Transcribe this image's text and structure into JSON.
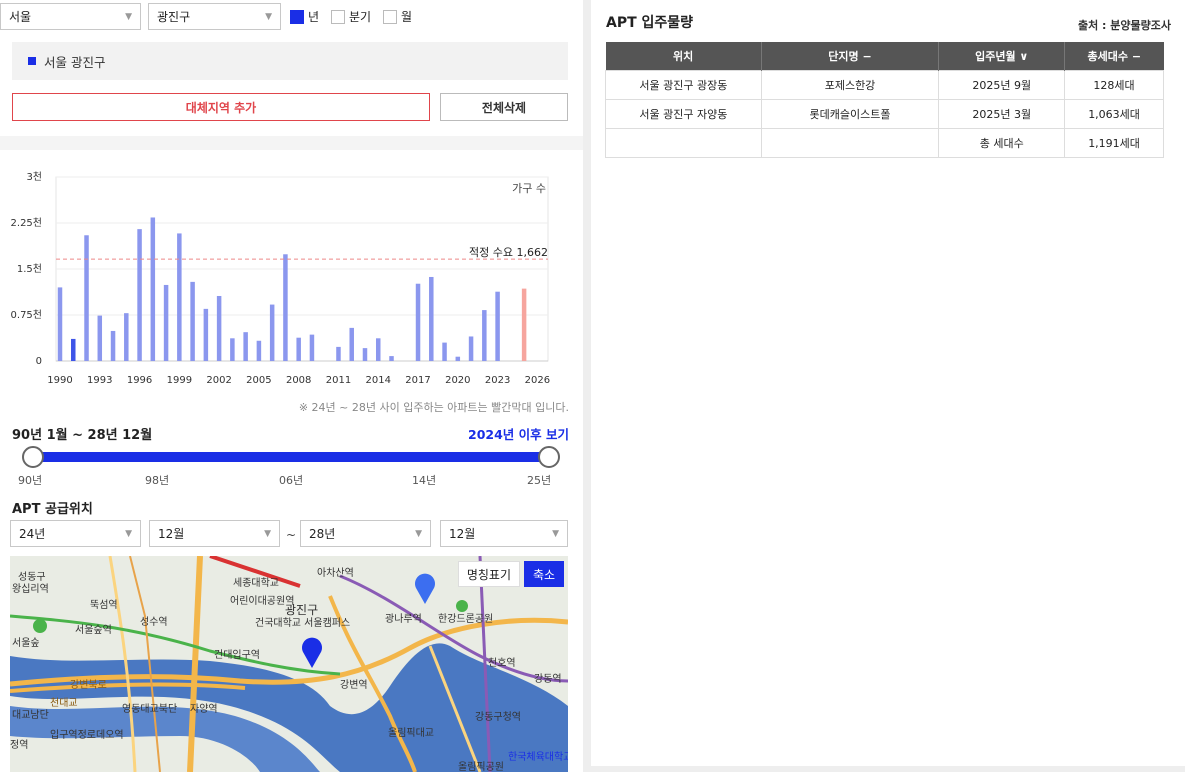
{
  "filters": {
    "city": "서울",
    "district": "광진구",
    "period_options": [
      {
        "label": "년",
        "checked": true
      },
      {
        "label": "분기",
        "checked": false
      },
      {
        "label": "월",
        "checked": false
      }
    ]
  },
  "region_selected": "서울 광진구",
  "buttons": {
    "add_region": "대체지역 추가",
    "clear_all": "전체삭제"
  },
  "chart_data": {
    "type": "bar",
    "series_label": "가구 수",
    "reference_line": {
      "label": "적정 수요 1,662",
      "value": 1662,
      "color": "#e88"
    },
    "y_ticks": [
      "0",
      "0.75천",
      "1.5천",
      "2.25천",
      "3천"
    ],
    "ylim": [
      0,
      3000
    ],
    "x_tick_labels": [
      "1990",
      "1993",
      "1996",
      "1999",
      "2002",
      "2005",
      "2008",
      "2011",
      "2014",
      "2017",
      "2020",
      "2023",
      "2026"
    ],
    "x": [
      1990,
      1991,
      1992,
      1993,
      1994,
      1995,
      1996,
      1997,
      1998,
      1999,
      2000,
      2001,
      2002,
      2003,
      2004,
      2005,
      2006,
      2007,
      2008,
      2009,
      2010,
      2011,
      2012,
      2013,
      2014,
      2015,
      2016,
      2017,
      2018,
      2019,
      2020,
      2021,
      2022,
      2023,
      2024,
      2025
    ],
    "values": [
      1200,
      360,
      2050,
      740,
      490,
      780,
      2150,
      2340,
      1240,
      2080,
      1290,
      850,
      1060,
      370,
      470,
      330,
      920,
      1740,
      380,
      430,
      0,
      230,
      540,
      210,
      370,
      80,
      0,
      1260,
      1370,
      300,
      70,
      400,
      830,
      1130,
      0,
      1180
    ],
    "highlight_index": 1,
    "forecast_index": 35,
    "bar_color": "#8b97ee",
    "highlight_color": "#3e55e8",
    "forecast_color": "#f6a59e",
    "note": "※ 24년 ~ 28년 사이 입주하는 아파트는 빨간막대 입니다."
  },
  "period": {
    "title": "90년 1월 ~ 28년 12월",
    "link": "2024년 이후 보기"
  },
  "slider_ticks": [
    "90년",
    "98년",
    "06년",
    "14년",
    "25년"
  ],
  "supply": {
    "title": "APT 공급위치",
    "from_year": "24년",
    "from_month": "12월",
    "tilde": "~",
    "to_year": "28년",
    "to_month": "12월"
  },
  "map": {
    "label_toggle": "명칭표기",
    "zoom": "축소",
    "places": [
      "성동구",
      "왕십리역",
      "세종대학교",
      "아차산역",
      "광진구",
      "뚝섬역",
      "어린이대공원역",
      "서울숲역",
      "성수역",
      "건국대학교 서울캠퍼스",
      "광나루역",
      "한강드론공원",
      "서울숲",
      "건대입구역",
      "천호역",
      "강변역",
      "강동역",
      "대교남단",
      "영동대교북단",
      "자양역",
      "강동구청역",
      "입구역정로데오역",
      "올림픽대교",
      "한국체육대학교",
      "정역",
      "강변북로",
      "천대교",
      "올림픽공원"
    ]
  },
  "apt": {
    "title": "APT 입주물량",
    "source": "출처 : 분양물량조사",
    "headers": [
      "위치",
      "단지명 −",
      "입주년월 ∨",
      "총세대수 −"
    ],
    "rows": [
      [
        "서울 광진구 광장동",
        "포제스한강",
        "2025년 9월",
        "128세대"
      ],
      [
        "서울 광진구 자양동",
        "롯데캐슬이스트폴",
        "2025년 3월",
        "1,063세대"
      ]
    ],
    "total_label": "총 세대수",
    "total_value": "1,191세대"
  }
}
